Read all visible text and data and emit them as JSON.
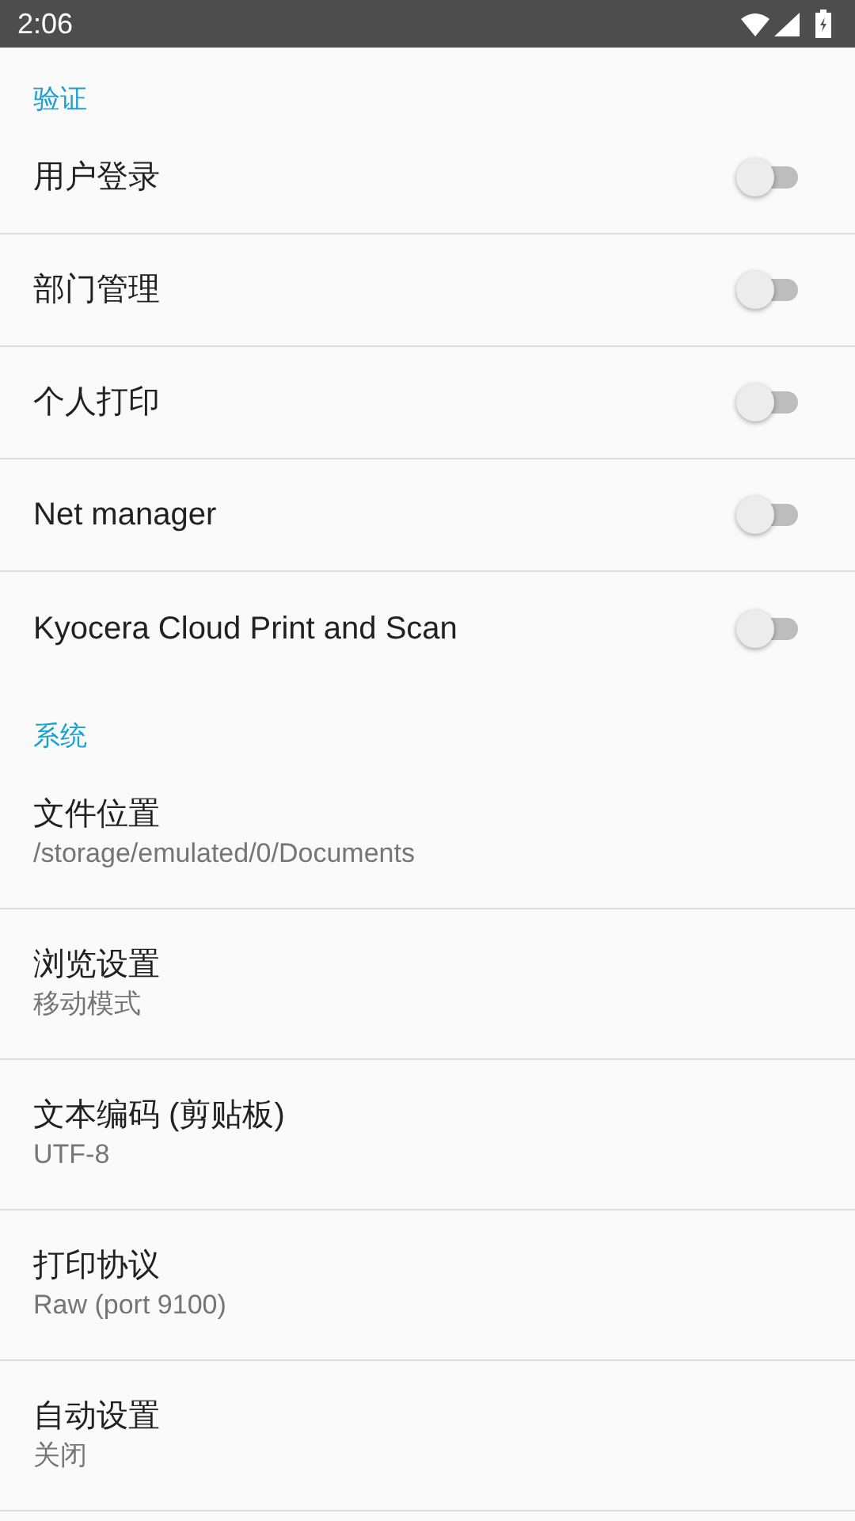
{
  "status_bar": {
    "time": "2:06"
  },
  "sections": [
    {
      "title": "验证",
      "items": [
        {
          "kind": "switch",
          "title": "用户登录",
          "on": false
        },
        {
          "kind": "switch",
          "title": "部门管理",
          "on": false
        },
        {
          "kind": "switch",
          "title": "个人打印",
          "on": false
        },
        {
          "kind": "switch",
          "title": "Net manager",
          "on": false
        },
        {
          "kind": "switch",
          "title": "Kyocera Cloud Print and Scan",
          "on": false
        }
      ]
    },
    {
      "title": "系统",
      "items": [
        {
          "kind": "text",
          "title": "文件位置",
          "summary": "/storage/emulated/0/Documents"
        },
        {
          "kind": "text",
          "title": "浏览设置",
          "summary": "移动模式"
        },
        {
          "kind": "text",
          "title": "文本编码 (剪贴板)",
          "summary": "UTF-8"
        },
        {
          "kind": "text",
          "title": "打印协议",
          "summary": "Raw (port 9100)"
        },
        {
          "kind": "text",
          "title": "自动设置",
          "summary": "关闭"
        }
      ]
    }
  ]
}
